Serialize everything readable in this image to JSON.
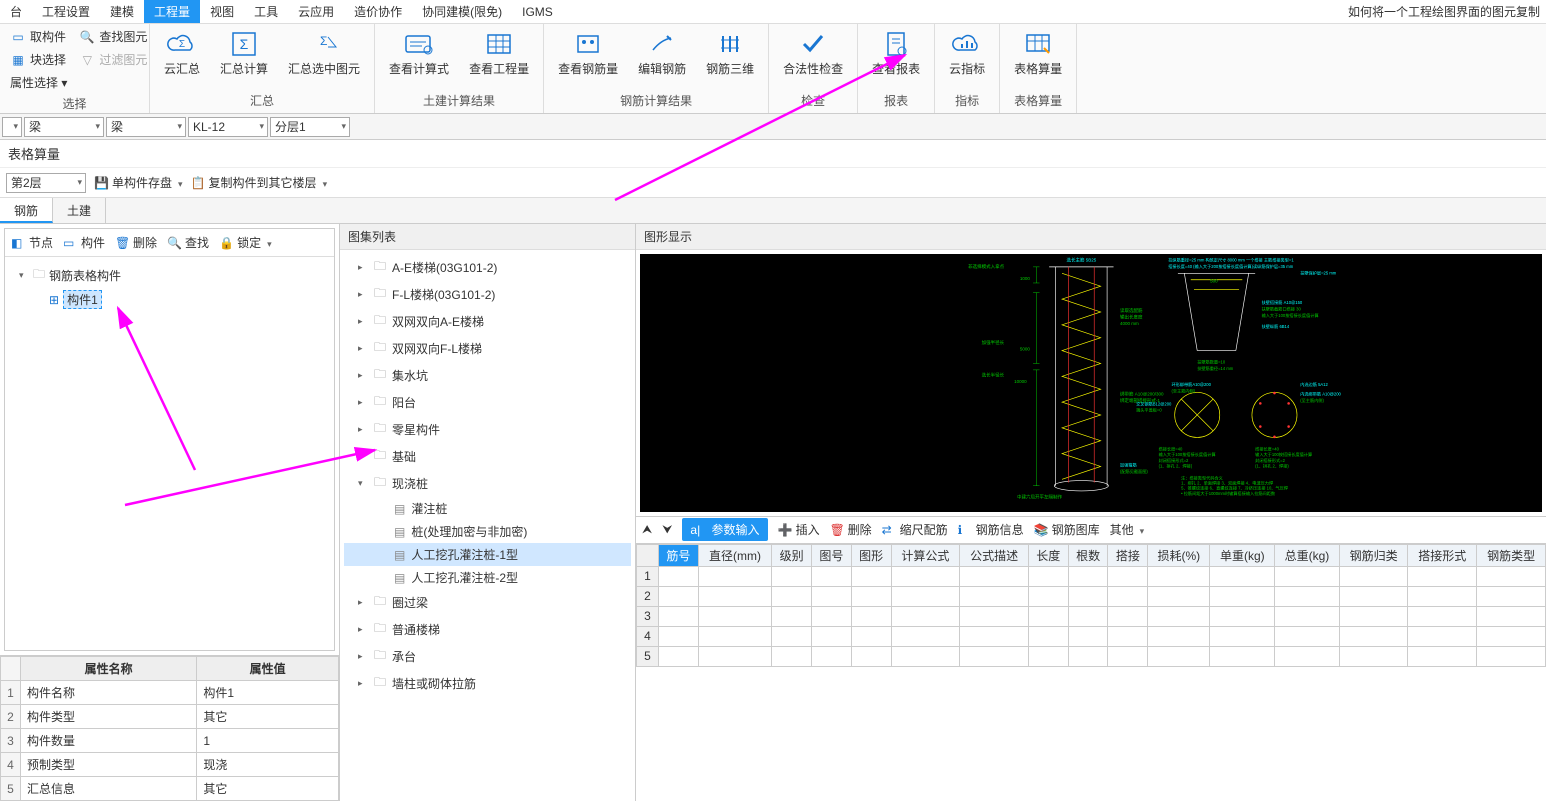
{
  "menu": {
    "items": [
      "台",
      "工程设置",
      "建模",
      "工程量",
      "视图",
      "工具",
      "云应用",
      "造价协作",
      "协同建模(限免)",
      "IGMS"
    ],
    "activeIndex": 3,
    "rightHint": "如何将一个工程绘图界面的图元复制"
  },
  "ribbon": {
    "g_select": {
      "label": "选择",
      "btns": [
        "取构件",
        "块选择",
        "属性选择 ▾",
        "查找图元",
        "过滤图元"
      ]
    },
    "g_sum": {
      "label": "汇总",
      "btns": [
        "云汇总",
        "汇总计算",
        "汇总选中图元"
      ]
    },
    "g_civil": {
      "label": "土建计算结果",
      "btns": [
        "查看计算式",
        "查看工程量"
      ]
    },
    "g_rebar": {
      "label": "钢筋计算结果",
      "btns": [
        "查看钢筋量",
        "编辑钢筋",
        "钢筋三维"
      ]
    },
    "g_check": {
      "label": "检查",
      "btns": [
        "合法性检查"
      ]
    },
    "g_report": {
      "label": "报表",
      "btns": [
        "查看报表"
      ]
    },
    "g_index": {
      "label": "指标",
      "btns": [
        "云指标"
      ]
    },
    "g_sheet": {
      "label": "表格算量",
      "btns": [
        "表格算量"
      ]
    }
  },
  "filter": {
    "d1": "",
    "d2": "梁",
    "d3": "梁",
    "d4": "KL-12",
    "d5": "分层1"
  },
  "panelTitle": "表格算量",
  "toolbar2": {
    "floor": "第2层",
    "saveSingle": "单构件存盘",
    "copy": "复制构件到其它楼层"
  },
  "tabs": {
    "t1": "钢筋",
    "t2": "土建",
    "active": 0
  },
  "leftTree": {
    "tb": [
      "节点",
      "构件",
      "删除",
      "查找",
      "锁定"
    ],
    "root": "钢筋表格构件",
    "child": "构件1"
  },
  "midPanel": {
    "title": "图集列表",
    "nodes": [
      {
        "t": "A-E楼梯(03G101-2)",
        "l": 1
      },
      {
        "t": "F-L楼梯(03G101-2)",
        "l": 1
      },
      {
        "t": "双网双向A-E楼梯",
        "l": 1
      },
      {
        "t": "双网双向F-L楼梯",
        "l": 1
      },
      {
        "t": "集水坑",
        "l": 1
      },
      {
        "t": "阳台",
        "l": 1
      },
      {
        "t": "零星构件",
        "l": 1
      },
      {
        "t": "基础",
        "l": 1
      },
      {
        "t": "现浇桩",
        "l": 1,
        "exp": true
      },
      {
        "t": "灌注桩",
        "l": 2
      },
      {
        "t": "桩(处理加密与非加密)",
        "l": 2
      },
      {
        "t": "人工挖孔灌注桩-1型",
        "l": 2,
        "sel": true
      },
      {
        "t": "人工挖孔灌注桩-2型",
        "l": 2
      },
      {
        "t": "圈过梁",
        "l": 1
      },
      {
        "t": "普通楼梯",
        "l": 1
      },
      {
        "t": "承台",
        "l": 1
      },
      {
        "t": "墙柱或砌体拉筋",
        "l": 1
      }
    ]
  },
  "rightTitle": "图形显示",
  "cadLabels": {
    "a": "非选择模式入拿点",
    "b": "1000",
    "c": "加强半径长",
    "d": "5000",
    "e": "选长半径长",
    "f": "10000",
    "g": "选长主筋 5B25",
    "h": "500",
    "i": "读取选配筋",
    "j": "输出长度度",
    "k": "4000 mm",
    "l": "绑带筋 A10@200/300",
    "m": "绑定端部搭接形式-1",
    "n": "中建六局开平左隔制作",
    "t1": "拉纵筋重径=25 mm  构筑定尺寸 8000 mm 一个搭接   主筋搭接类型=1",
    "t2": "搭接长度=40   (输入大于200按搭接长度值计算)读纵筋保护层=35 mm",
    "t3": "扶壁保护层=25 mm",
    "t4": "扶壁搭接筋 A10@150",
    "t5": "扶壁筋截筋口搭接 30",
    "t6": "输入大于100按搭接长度值计算",
    "t7": "扶壁纵筋 6B14",
    "t8": "扶壁筋数量=10",
    "t9": "扶壁筋重径=14 mm",
    "t10": "环形绑带筋A10@200",
    "t11": "内选边筋 5A12",
    "t12": "(至主筋内侧)",
    "t13": "内选绑带筋 A10@200",
    "t14": "(至主筋内侧)",
    "t15": "交叉钢筋B12@200",
    "t16": "端头平盖板=0",
    "t17": "搭接长度=40",
    "t18": "输入大于100按搭接长度值计算",
    "t19": "封闭搭接形式=2",
    "t20": "(1、拼孔  2、焊接)",
    "t21": "加强箍筋",
    "t22": "(配筋见截面图)",
    "note": "注：搭接类型代码含义\n1、绑扎        2、单面焊接    3、双面焊接    4、电渣压力焊\n5、锥螺纹连接  6、直螺纹连接  7、冷挤压连接  10、气压焊\n• 拉筋间距大于1000mm时输算搭接输入拉筋间距数"
  },
  "props": {
    "h1": "属性名称",
    "h2": "属性值",
    "rows": [
      {
        "n": "构件名称",
        "v": "构件1"
      },
      {
        "n": "构件类型",
        "v": "其它"
      },
      {
        "n": "构件数量",
        "v": "1"
      },
      {
        "n": "预制类型",
        "v": "现浇"
      },
      {
        "n": "汇总信息",
        "v": "其它"
      }
    ]
  },
  "bottomTb": {
    "paramInput": "参数输入",
    "insert": "插入",
    "delete": "删除",
    "scale": "缩尺配筋",
    "info": "钢筋信息",
    "lib": "钢筋图库",
    "other": "其他"
  },
  "grid": {
    "cols": [
      "筋号",
      "直径(mm)",
      "级别",
      "图号",
      "图形",
      "计算公式",
      "公式描述",
      "长度",
      "根数",
      "搭接",
      "损耗(%)",
      "单重(kg)",
      "总重(kg)",
      "钢筋归类",
      "搭接形式",
      "钢筋类型"
    ],
    "rows": 5
  }
}
